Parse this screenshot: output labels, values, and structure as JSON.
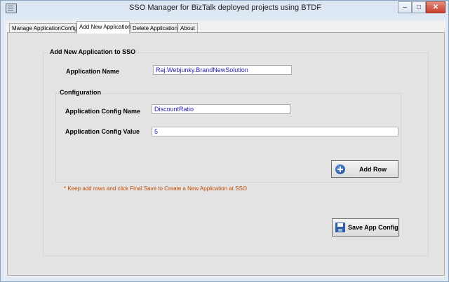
{
  "window": {
    "title": "SSO Manager for BizTalk deployed projects  using BTDF",
    "min_glyph": "–",
    "max_glyph": "□",
    "close_glyph": "✕"
  },
  "tabs": [
    {
      "label": "Manage ApplicationConfig",
      "active": false
    },
    {
      "label": "Add New Application",
      "active": true
    },
    {
      "label": "Delete Application",
      "active": false
    },
    {
      "label": "About",
      "active": false
    }
  ],
  "main_group": {
    "title": "Add New Application to SSO",
    "app_name_label": "Application Name",
    "app_name_value": "Raj.Webjunky.BrandNewSolution"
  },
  "config_group": {
    "title": "Configuration",
    "config_name_label": "Application Config Name",
    "config_name_value": "DiscountRatio",
    "config_value_label": "Application Config Value",
    "config_value_value": "5",
    "add_row_label": "Add Row"
  },
  "note": "*  Keep add rows and click Final Save to Create a New Application at SSO",
  "save_label": "Save App Config",
  "colors": {
    "input_text": "#1f1fb0",
    "note_text": "#c04a00"
  }
}
